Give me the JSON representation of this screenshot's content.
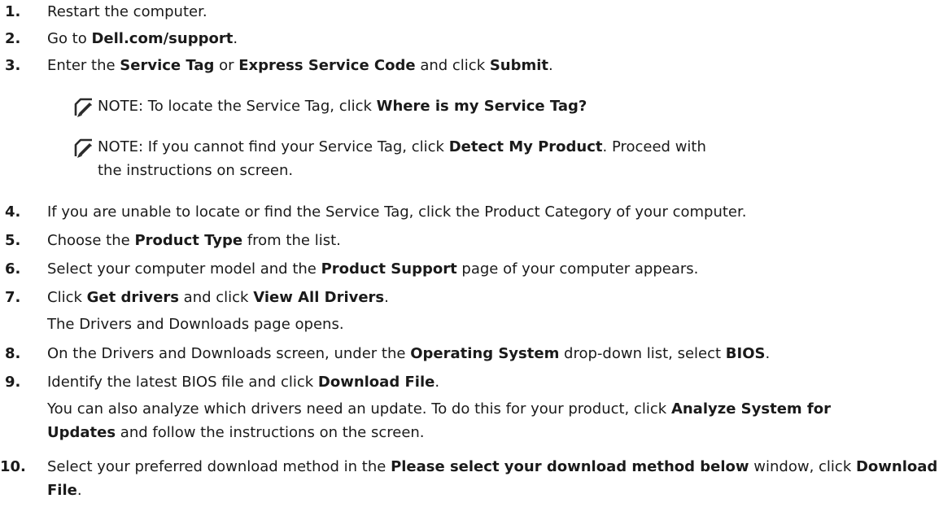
{
  "steps": [
    {
      "n": "1.",
      "parts": [
        {
          "t": "Restart the computer."
        }
      ]
    },
    {
      "n": "2.",
      "parts": [
        {
          "t": "Go to "
        },
        {
          "t": "Dell.com/support",
          "b": true
        },
        {
          "t": "."
        }
      ]
    },
    {
      "n": "3.",
      "parts": [
        {
          "t": "Enter the "
        },
        {
          "t": "Service Tag",
          "b": true
        },
        {
          "t": " or "
        },
        {
          "t": "Express Service Code",
          "b": true
        },
        {
          "t": " and click "
        },
        {
          "t": "Submit",
          "b": true
        },
        {
          "t": "."
        }
      ]
    },
    {
      "n": "4.",
      "parts": [
        {
          "t": "If you are unable to locate or find the Service Tag, click the Product Category of your computer."
        }
      ]
    },
    {
      "n": "5.",
      "parts": [
        {
          "t": "Choose the "
        },
        {
          "t": "Product Type",
          "b": true
        },
        {
          "t": " from the list."
        }
      ]
    },
    {
      "n": "6.",
      "parts": [
        {
          "t": "Select your computer model and the "
        },
        {
          "t": "Product Support",
          "b": true
        },
        {
          "t": " page of your computer appears."
        }
      ]
    },
    {
      "n": "7.",
      "parts": [
        {
          "t": "Click "
        },
        {
          "t": "Get drivers",
          "b": true
        },
        {
          "t": " and click "
        },
        {
          "t": "View All Drivers",
          "b": true
        },
        {
          "t": "."
        }
      ]
    },
    {
      "n": "8.",
      "parts": [
        {
          "t": "On the Drivers and Downloads screen, under the "
        },
        {
          "t": "Operating System",
          "b": true
        },
        {
          "t": " drop-down list, select "
        },
        {
          "t": "BIOS",
          "b": true
        },
        {
          "t": "."
        }
      ]
    },
    {
      "n": "9.",
      "parts": [
        {
          "t": "Identify the latest BIOS file and click "
        },
        {
          "t": "Download File",
          "b": true
        },
        {
          "t": "."
        }
      ]
    },
    {
      "n": "10.",
      "parts": [
        {
          "t": "Select your preferred download method in the "
        },
        {
          "t": "Please select your download method below",
          "b": true
        },
        {
          "t": " window, click "
        },
        {
          "t": "Download File",
          "b": true
        },
        {
          "t": "."
        }
      ]
    }
  ],
  "notes": [
    {
      "label": "NOTE:",
      "parts": [
        {
          "t": " To locate the Service Tag, click "
        },
        {
          "t": "Where is my Service Tag?",
          "b": true
        }
      ]
    },
    {
      "label": "NOTE:",
      "parts": [
        {
          "t": " If you cannot find your Service Tag, click "
        },
        {
          "t": "Detect My Product",
          "b": true
        },
        {
          "t": ". Proceed with the instructions on screen."
        }
      ]
    }
  ],
  "step7_result": "The Drivers and Downloads page opens.",
  "step9_extra": [
    {
      "t": "You can also analyze which drivers need an update. To do this for your product, click "
    },
    {
      "t": "Analyze System for Updates",
      "b": true
    },
    {
      "t": " and follow the instructions on the screen."
    }
  ],
  "icons": {
    "note": "pencil-note-icon"
  }
}
